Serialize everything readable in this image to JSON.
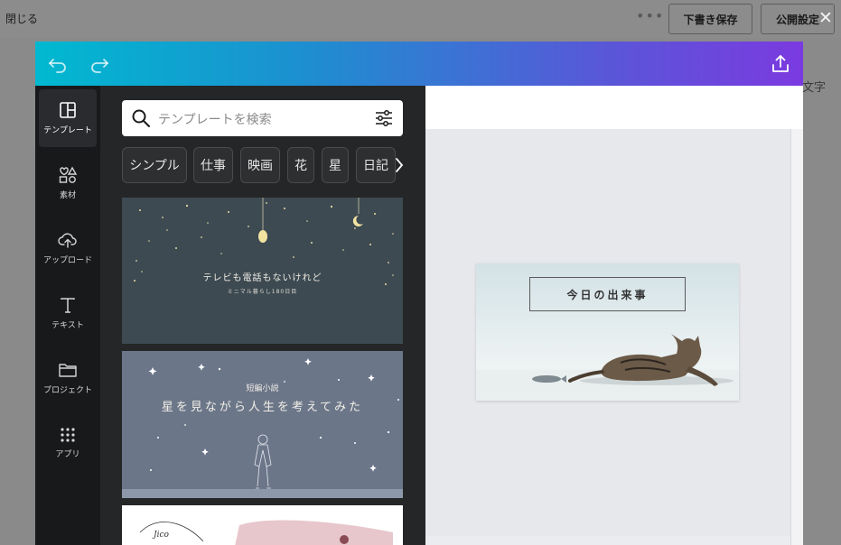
{
  "page": {
    "close_label": "閉じる",
    "more_label": "•••",
    "draft_button": "下書き保存",
    "publish_button": "公開設定",
    "close_x": "✕",
    "behind_text": "文字"
  },
  "editor": {
    "rail": [
      {
        "label": "テンプレート",
        "icon": "template-icon"
      },
      {
        "label": "素材",
        "icon": "elements-icon"
      },
      {
        "label": "アップロード",
        "icon": "upload-icon"
      },
      {
        "label": "テキスト",
        "icon": "text-icon"
      },
      {
        "label": "プロジェクト",
        "icon": "folder-icon"
      },
      {
        "label": "アプリ",
        "icon": "apps-icon"
      }
    ],
    "search": {
      "placeholder": "テンプレートを検索"
    },
    "chips": [
      "シンプル",
      "仕事",
      "映画",
      "花",
      "星",
      "日記"
    ],
    "templates": [
      {
        "title": "テレビも電話もないけれど",
        "subtitle": "ミニマル暮らし180日目"
      },
      {
        "title": "星を見ながら人生を考えてみた",
        "subtitle": "短編小説"
      },
      {
        "title": "Jico"
      }
    ],
    "collapse_glyph": "‹",
    "design": {
      "title": "今日の出来事"
    }
  },
  "colors": {
    "header_start": "#00b9d0",
    "header_end": "#7b3ae0",
    "rail_bg": "#18191b",
    "panel_bg": "#252627"
  }
}
